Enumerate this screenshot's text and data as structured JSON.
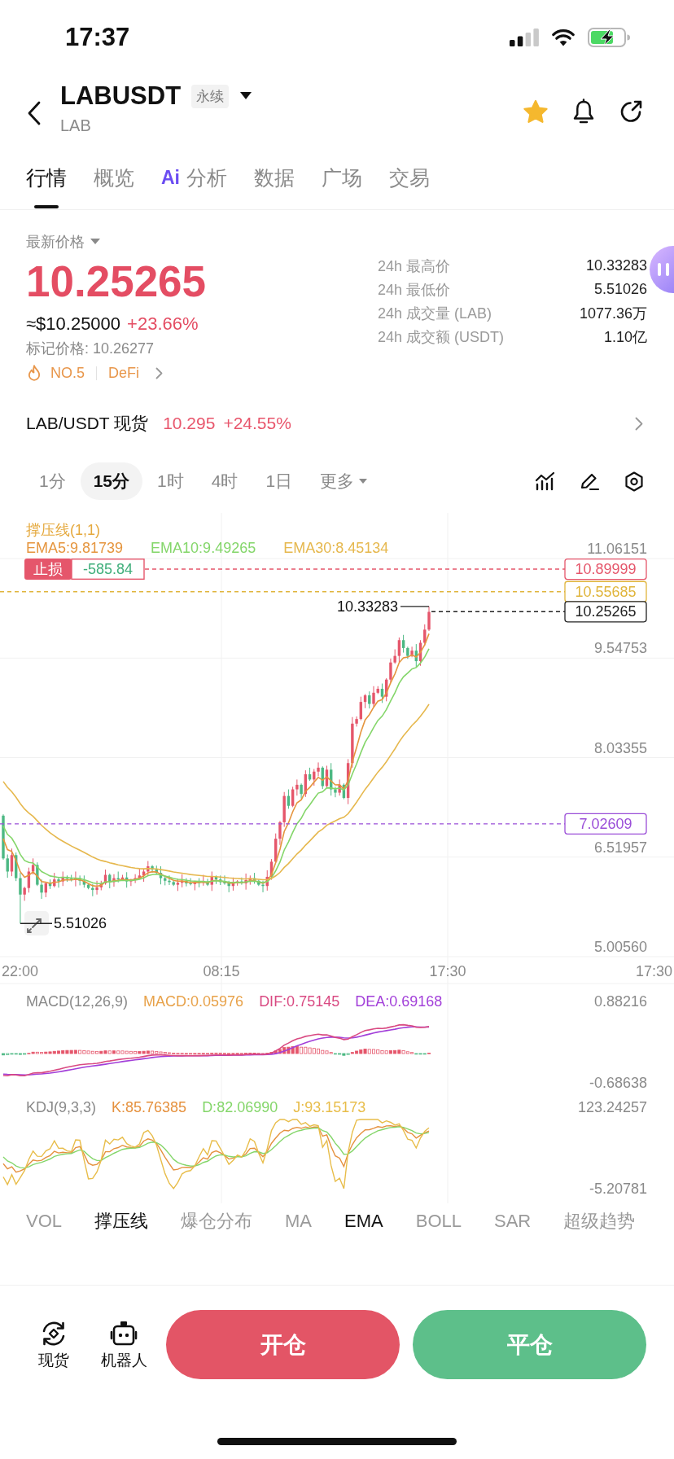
{
  "status_bar": {
    "time": "17:37"
  },
  "header": {
    "symbol": "LABUSDT",
    "contract_type": "永续",
    "base_asset": "LAB",
    "favorite": true
  },
  "tabs": [
    {
      "label": "行情",
      "selected": true
    },
    {
      "label": "概览",
      "selected": false
    },
    {
      "label": "分析",
      "prefix": "Ai",
      "selected": false
    },
    {
      "label": "数据",
      "selected": false
    },
    {
      "label": "广场",
      "selected": false
    },
    {
      "label": "交易",
      "selected": false
    }
  ],
  "ticker": {
    "label": "最新价格",
    "last_price": "10.25265",
    "usd_price": "≈$10.25000",
    "change": "+23.66%",
    "mark_price": "标记价格: 10.26277",
    "rank": "NO.5",
    "sector": "DeFi"
  },
  "stats": [
    {
      "label": "24h 最高价",
      "value": "10.33283"
    },
    {
      "label": "24h 最低价",
      "value": "5.51026"
    },
    {
      "label": "24h 成交量 (LAB)",
      "value": "1077.36万"
    },
    {
      "label": "24h 成交额 (USDT)",
      "value": "1.10亿"
    }
  ],
  "spot": {
    "pair": "LAB/USDT 现货",
    "price": "10.295",
    "change": "+24.55%"
  },
  "timeframes": [
    {
      "label": "1分",
      "kind": "interval",
      "selected": false
    },
    {
      "label": "15分",
      "kind": "interval",
      "selected": true
    },
    {
      "label": "1时",
      "kind": "interval",
      "selected": false
    },
    {
      "label": "4时",
      "kind": "interval",
      "selected": false
    },
    {
      "label": "1日",
      "kind": "interval",
      "selected": false
    },
    {
      "label": "更多",
      "kind": "dropdown",
      "selected": false
    }
  ],
  "chart": {
    "indicator": "撑压线(1,1)",
    "legend": [
      {
        "text": "EMA5:9.81739",
        "color": "#e5953e"
      },
      {
        "text": "EMA10:9.49265",
        "color": "#84d66a"
      },
      {
        "text": "EMA30:8.45134",
        "color": "#e6b84e"
      }
    ],
    "y_ticks": [
      "11.06151",
      "9.54753",
      "8.03355",
      "6.51957",
      "5.00560"
    ],
    "x_ticks": [
      "22:00",
      "08:15",
      "17:30",
      "17:30"
    ],
    "high": "10.33283",
    "low": "5.51026",
    "price_lines": [
      {
        "kind": "stop_loss",
        "label": "止损",
        "pnl": "-585.84",
        "price": "10.89999",
        "color": "#e5566b"
      },
      {
        "kind": "level",
        "price": "10.55685",
        "color": "#e0b53c"
      },
      {
        "kind": "last",
        "price": "10.25265",
        "color": "#222222"
      },
      {
        "kind": "alert",
        "price": "7.02609",
        "color": "#9b4fd8"
      }
    ]
  },
  "macd": {
    "title": "MACD(12,26,9)",
    "legend": [
      {
        "text": "MACD:0.05976",
        "color": "#e8a24a"
      },
      {
        "text": "DIF:0.75145",
        "color": "#d94a82"
      },
      {
        "text": "DEA:0.69168",
        "color": "#a23fd9"
      }
    ],
    "y_ticks": [
      "0.88216",
      "-0.68638"
    ]
  },
  "kdj": {
    "title": "KDJ(9,3,3)",
    "legend": [
      {
        "text": "K:85.76385",
        "color": "#e5913e"
      },
      {
        "text": "D:82.06990",
        "color": "#84d66a"
      },
      {
        "text": "J:93.15173",
        "color": "#e8bd4a"
      }
    ],
    "y_ticks": [
      "123.24257",
      "-5.20781"
    ]
  },
  "indicators": [
    {
      "label": "VOL",
      "selected": false
    },
    {
      "label": "撑压线",
      "selected": true
    },
    {
      "label": "爆仓分布",
      "selected": false
    },
    {
      "label": "MA",
      "selected": false
    },
    {
      "label": "EMA",
      "selected": true
    },
    {
      "label": "BOLL",
      "selected": false
    },
    {
      "label": "SAR",
      "selected": false
    },
    {
      "label": "超级趋势",
      "selected": false
    }
  ],
  "bottom_nav": [
    {
      "label": "现货",
      "kind": "spot"
    },
    {
      "label": "机器人",
      "kind": "robot"
    }
  ],
  "actions": [
    {
      "label": "开仓",
      "kind": "open"
    },
    {
      "label": "平仓",
      "kind": "close"
    }
  ]
}
